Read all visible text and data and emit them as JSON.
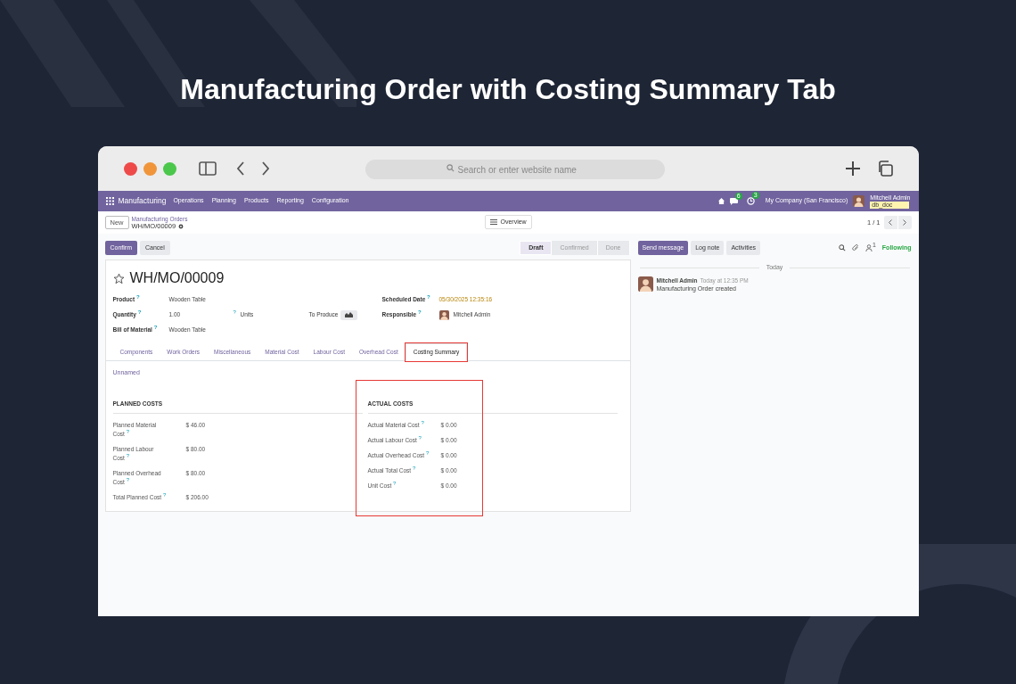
{
  "headline": "Manufacturing Order with Costing Summary Tab",
  "browser": {
    "address_placeholder": "Search or enter website name"
  },
  "navbar": {
    "app": "Manufacturing",
    "menus": [
      "Operations",
      "Planning",
      "Products",
      "Reporting",
      "Configuration"
    ],
    "message_count": "6",
    "activity_count": "3",
    "company": "My Company (San Francisco)",
    "user": "Mitchell Admin",
    "database": "db_doc"
  },
  "control_bar": {
    "new_button": "New",
    "breadcrumb_parent": "Manufacturing Orders",
    "breadcrumb_current": "WH/MO/00009",
    "view_button": "Overview",
    "pager": "1 / 1"
  },
  "actions": [
    {
      "label": "Confirm",
      "primary": true
    },
    {
      "label": "Cancel",
      "primary": false
    }
  ],
  "status_steps": [
    {
      "label": "Draft",
      "selected": true
    },
    {
      "label": "Confirmed",
      "selected": false
    },
    {
      "label": "Done",
      "selected": false
    }
  ],
  "chatter": {
    "buttons": [
      {
        "label": "Send message",
        "primary": true
      },
      {
        "label": "Log note",
        "primary": false
      },
      {
        "label": "Activities",
        "primary": false
      }
    ],
    "follower_count": "1",
    "follow_state": "Following",
    "date_separator": "Today",
    "messages": [
      {
        "author": "Mitchell Admin",
        "time": "Today at 12:35 PM",
        "body": "Manufacturing Order created"
      }
    ]
  },
  "form": {
    "title": "WH/MO/00009",
    "starred": false,
    "left_fields": [
      {
        "label": "Product $^{?}$",
        "value": "Wooden Table"
      },
      {
        "label": "Quantity $^{?}$",
        "value": "1.00",
        "unit_help": "?",
        "unit": "Units",
        "extra_label": "To Produce"
      },
      {
        "label": "Bill of Material $^{?}$",
        "value": "Wooden Table"
      }
    ],
    "right_fields": [
      {
        "label": "Scheduled Date $^{?}$",
        "value": "05/30/2025 12:35:16",
        "kind": "date"
      },
      {
        "label": "Responsible $^{?}$",
        "value": "Mitchell Admin",
        "kind": "user"
      }
    ],
    "tabs": [
      {
        "label": "Components",
        "selected": false,
        "highlighted": false
      },
      {
        "label": "Work Orders",
        "selected": false,
        "highlighted": false
      },
      {
        "label": "Miscellaneous",
        "selected": false,
        "highlighted": false
      },
      {
        "label": "Material Cost",
        "selected": false,
        "highlighted": false
      },
      {
        "label": "Labour Cost",
        "selected": false,
        "highlighted": false
      },
      {
        "label": "Overhead Cost",
        "selected": false,
        "highlighted": false
      },
      {
        "label": "Costing Summary",
        "selected": true,
        "highlighted": true
      }
    ],
    "link": "Unnamed",
    "sections": [
      {
        "title": "PLANNED COSTS",
        "highlighted": false,
        "rows": [
          {
            "label": "Planned Material Cost $^{?}$",
            "value": "$ 46.00"
          },
          {
            "label": "Planned Labour Cost $^{?}$",
            "value": "$ 80.00"
          },
          {
            "label": "Planned Overhead Cost $^{?}$",
            "value": "$ 80.00"
          },
          {
            "label": "Total Planned Cost $^{?}$",
            "value": "$ 206.00"
          }
        ]
      },
      {
        "title": "ACTUAL COSTS",
        "highlighted": true,
        "rows": [
          {
            "label": "Actual Material Cost $^{?}$",
            "value": "$ 0.00"
          },
          {
            "label": "Actual Labour Cost $^{?}$",
            "value": "$ 0.00"
          },
          {
            "label": "Actual Overhead Cost $^{?}$",
            "value": "$ 0.00"
          },
          {
            "label": "Actual Total Cost $^{?}$",
            "value": "$ 0.00"
          },
          {
            "label": "Unit Cost $^{?}$",
            "value": "$ 0.00"
          }
        ]
      }
    ]
  }
}
